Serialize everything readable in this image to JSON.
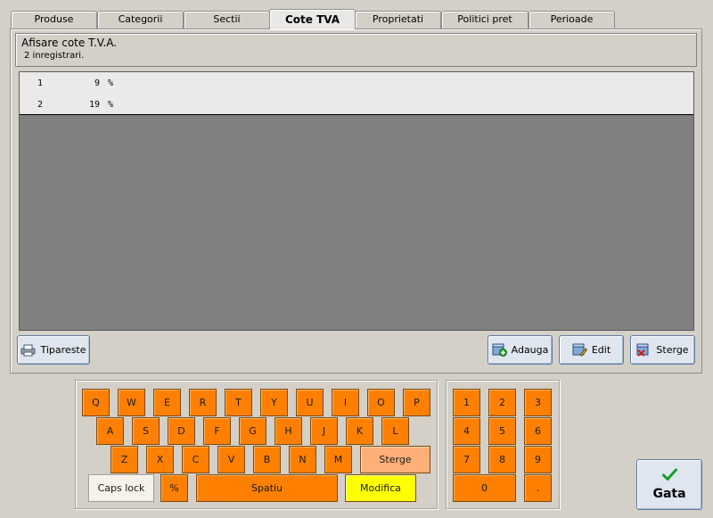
{
  "tabs": [
    {
      "label": "Produse",
      "active": false
    },
    {
      "label": "Categorii",
      "active": false
    },
    {
      "label": "Sectii",
      "active": false
    },
    {
      "label": "Cote TVA",
      "active": true
    },
    {
      "label": "Proprietati",
      "active": false
    },
    {
      "label": "Politici pret",
      "active": false
    },
    {
      "label": "Perioade",
      "active": false
    }
  ],
  "header": {
    "title": "Afisare cote T.V.A.",
    "count": "2 inregistrari."
  },
  "rows": [
    {
      "id": "1",
      "value": "9",
      "unit": "%"
    },
    {
      "id": "2",
      "value": "19",
      "unit": "%"
    }
  ],
  "buttons": {
    "print": "Tipareste",
    "add": "Adauga",
    "edit": "Edit",
    "delete": "Sterge",
    "done": "Gata"
  },
  "keyboard": {
    "row1": [
      "Q",
      "W",
      "E",
      "R",
      "T",
      "Y",
      "U",
      "I",
      "O",
      "P"
    ],
    "row2": [
      "A",
      "S",
      "D",
      "F",
      "G",
      "H",
      "J",
      "K",
      "L"
    ],
    "row3": [
      "Z",
      "X",
      "C",
      "V",
      "B",
      "N",
      "M"
    ],
    "backspace": "Sterge",
    "caps": "Caps lock",
    "percent": "%",
    "space": "Spatiu",
    "modify": "Modifica"
  },
  "numpad": {
    "keys": [
      "1",
      "2",
      "3",
      "4",
      "5",
      "6",
      "7",
      "8",
      "9"
    ],
    "zero": "0",
    "dot": "."
  },
  "colors": {
    "key": "#ff8000",
    "key_light": "#ffb078",
    "modify": "#ffff00",
    "grid": "#808080"
  }
}
